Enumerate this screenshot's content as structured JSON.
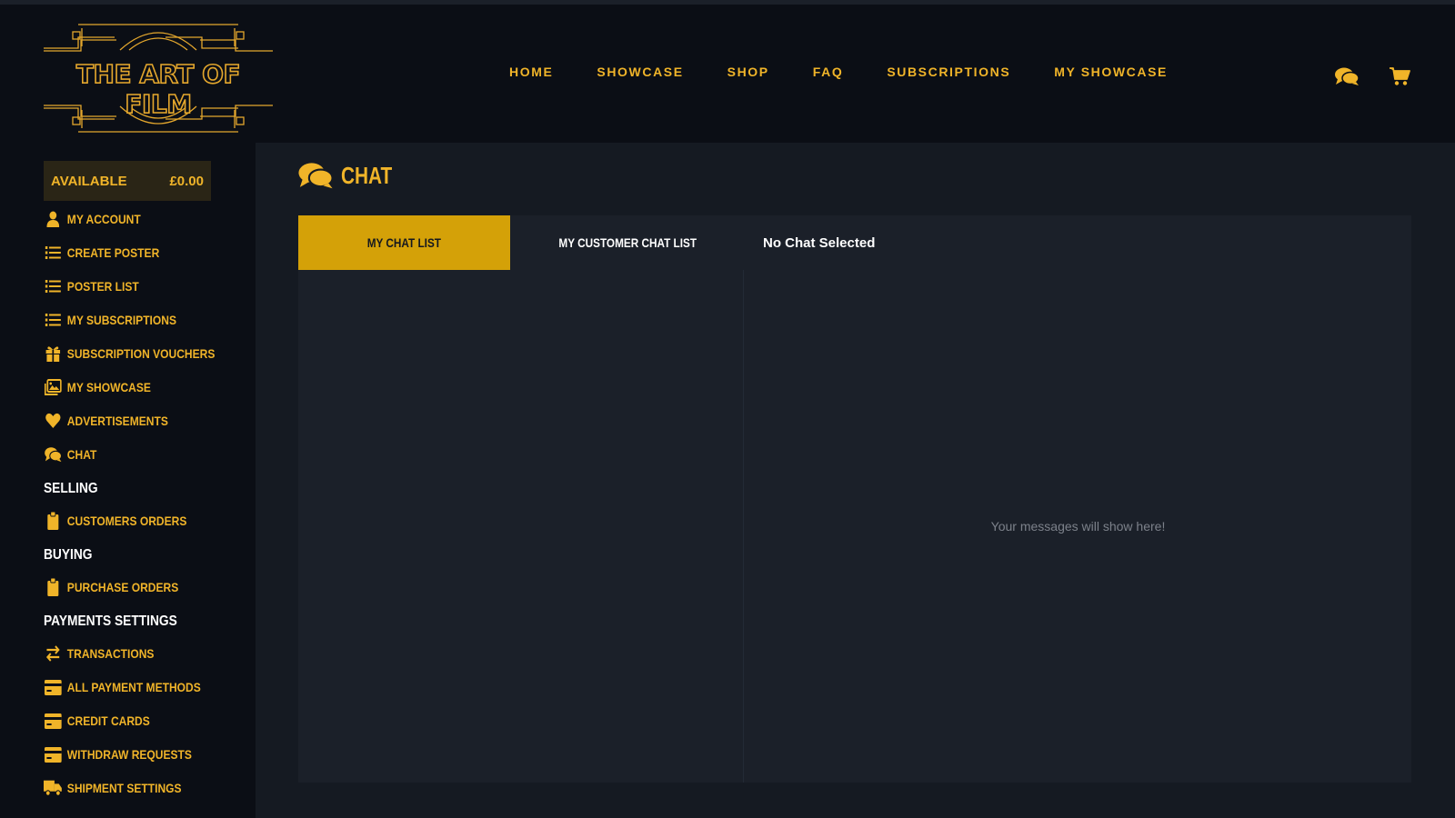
{
  "brand": {
    "logo_text": "THE ART OF FILM"
  },
  "nav": {
    "items": [
      "HOME",
      "SHOWCASE",
      "SHOP",
      "FAQ",
      "SUBSCRIPTIONS",
      "MY SHOWCASE"
    ]
  },
  "header_icons": [
    "chat-icon",
    "cart-icon"
  ],
  "sidebar": {
    "balance_label": "AVAILABLE",
    "balance_value": "£0.00",
    "items": [
      {
        "label": "MY ACCOUNT",
        "icon": "user-icon"
      },
      {
        "label": "CREATE POSTER",
        "icon": "list-icon"
      },
      {
        "label": "POSTER LIST",
        "icon": "list-icon"
      },
      {
        "label": "MY SUBSCRIPTIONS",
        "icon": "list-icon"
      },
      {
        "label": "SUBSCRIPTION VOUCHERS",
        "icon": "gift-icon"
      },
      {
        "label": "MY SHOWCASE",
        "icon": "images-icon"
      },
      {
        "label": "ADVERTISEMENTS",
        "icon": "heart-icon"
      },
      {
        "label": "CHAT",
        "icon": "comments-icon"
      }
    ],
    "selling_heading": "SELLING",
    "selling_items": [
      {
        "label": "CUSTOMERS ORDERS",
        "icon": "clipboard-icon"
      }
    ],
    "buying_heading": "BUYING",
    "buying_items": [
      {
        "label": "PURCHASE ORDERS",
        "icon": "clipboard-icon"
      }
    ],
    "payments_heading": "PAYMENTS SETTINGS",
    "payments_items": [
      {
        "label": "TRANSACTIONS",
        "icon": "exchange-icon"
      },
      {
        "label": "ALL PAYMENT METHODS",
        "icon": "credit-card-icon"
      },
      {
        "label": "CREDIT CARDS",
        "icon": "credit-card-icon"
      },
      {
        "label": "WITHDRAW REQUESTS",
        "icon": "credit-card-icon"
      },
      {
        "label": "SHIPMENT SETTINGS",
        "icon": "truck-icon"
      }
    ]
  },
  "main": {
    "title": "CHAT",
    "tabs": [
      {
        "label": "MY CHAT LIST",
        "active": true
      },
      {
        "label": "MY CUSTOMER CHAT LIST",
        "active": false
      }
    ],
    "chat_header": "No Chat Selected",
    "empty_message": "Your messages will show here!"
  },
  "colors": {
    "accent": "#f0b429",
    "tab_active": "#d4a108",
    "background": "#0b0e15",
    "panel": "#1b2029"
  }
}
